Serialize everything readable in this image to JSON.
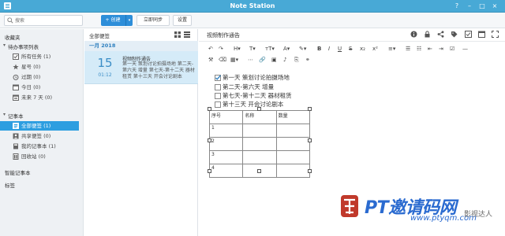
{
  "window": {
    "title": "Note Station",
    "controls": [
      "?",
      "–",
      "□",
      "×"
    ]
  },
  "toolbar": {
    "search_placeholder": "搜索",
    "new_label": "+ 创建",
    "new_dropdown": "▾",
    "sync_label": "立即同步",
    "settings_label": "设置"
  },
  "sidebar": {
    "favorites": "收藏夹",
    "todo_group": "待办事项列表",
    "todo_items": [
      {
        "label": "所有任务 (1)",
        "icon": "checkbox-icon"
      },
      {
        "label": "星号 (0)",
        "icon": "star-icon"
      },
      {
        "label": "过期 (0)",
        "icon": "alarm-icon"
      },
      {
        "label": "今日 (0)",
        "icon": "calendar-icon"
      },
      {
        "label": "未来 7 天 (0)",
        "icon": "calendar-week-icon"
      }
    ],
    "notebook_group": "记事本",
    "notebook_items": [
      {
        "label": "全部便签 (1)",
        "icon": "notes-icon",
        "active": true
      },
      {
        "label": "共享便签 (0)",
        "icon": "share-notes-icon"
      },
      {
        "label": "我的记事本 (1)",
        "icon": "notebook-icon"
      },
      {
        "label": "回收站 (0)",
        "icon": "trash-icon"
      }
    ],
    "smart_notebook": "智能记事本",
    "tags": "标签"
  },
  "list": {
    "header": "全部便签",
    "month": "一月 2018",
    "note": {
      "day": "15",
      "time": "01:12",
      "title": "视频制作通告",
      "snippet": "第一天 策划讨论拍摄场地 第二天-第六天 增量 第七天-第十二天 器材租赁 第十三天 开会讨论剧本"
    }
  },
  "editor": {
    "title": "视频制作通告",
    "todos": [
      {
        "label": "第一天 策划讨论拍摄场地",
        "checked": true
      },
      {
        "label": "第二天-第六天 增量",
        "checked": false
      },
      {
        "label": "第七天-第十二天 器材租赁",
        "checked": false
      },
      {
        "label": "第十三天 开会讨论剧本",
        "checked": false
      }
    ],
    "table": {
      "headers": [
        "序号",
        "名称",
        "数量"
      ],
      "rows": [
        [
          "1",
          "",
          ""
        ],
        [
          "2",
          "",
          ""
        ],
        [
          "3",
          "",
          ""
        ],
        [
          "4",
          "",
          ""
        ]
      ]
    }
  },
  "watermark": {
    "text": "PT邀请码网",
    "url": "www.ptyqm.com",
    "side": "影视达人"
  }
}
